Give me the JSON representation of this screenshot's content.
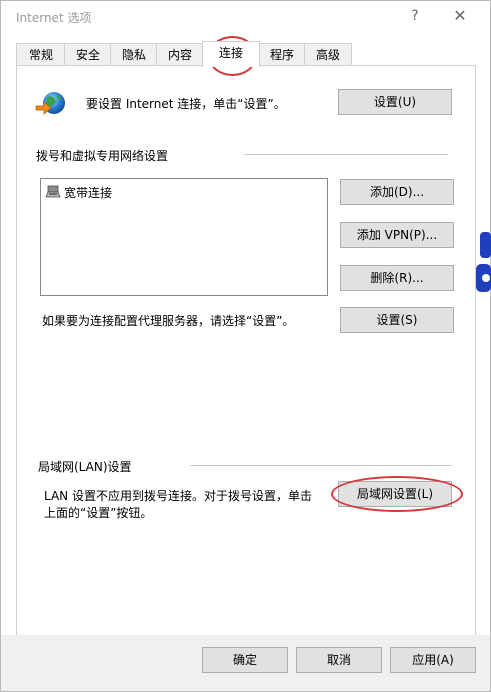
{
  "window": {
    "title": "Internet 选项",
    "help": "?",
    "close": "✕"
  },
  "tabs": [
    {
      "label": "常规"
    },
    {
      "label": "安全"
    },
    {
      "label": "隐私"
    },
    {
      "label": "内容"
    },
    {
      "label": "连接"
    },
    {
      "label": "程序"
    },
    {
      "label": "高级"
    }
  ],
  "active_tab": "连接",
  "setup": {
    "text": "要设置 Internet 连接，单击“设置”。",
    "button": "设置(U)"
  },
  "dialup": {
    "heading": "拨号和虚拟专用网络设置",
    "items": [
      {
        "label": "宽带连接"
      }
    ],
    "add": "添加(D)...",
    "add_vpn": "添加 VPN(P)...",
    "remove": "删除(R)...",
    "proxy_text": "如果要为连接配置代理服务器，请选择“设置”。",
    "settings": "设置(S)"
  },
  "lan": {
    "heading": "局域网(LAN)设置",
    "text_line1": "LAN 设置不应用到拨号连接。对于拨号设置，单击",
    "text_line2": "上面的“设置”按钮。",
    "button": "局域网设置(L)"
  },
  "footer": {
    "ok": "确定",
    "cancel": "取消",
    "apply": "应用(A)"
  },
  "colors": {
    "annotation_circle": "#d3393a",
    "button_face": "#e1e1e1",
    "footer_bg": "#f0f0f0"
  }
}
